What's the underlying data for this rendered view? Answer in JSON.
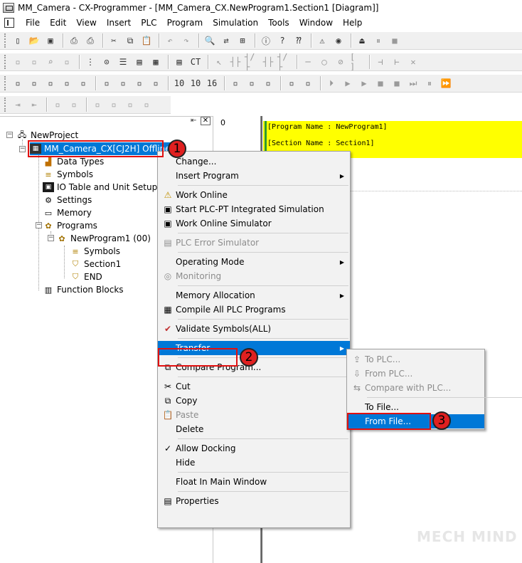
{
  "window": {
    "title": "MM_Camera - CX-Programmer - [MM_Camera_CX.NewProgram1.Section1 [Diagram]]"
  },
  "menubar": [
    "File",
    "Edit",
    "View",
    "Insert",
    "PLC",
    "Program",
    "Simulation",
    "Tools",
    "Window",
    "Help"
  ],
  "toolbars": {
    "row1": [
      "new-icon",
      "open-icon",
      "save-icon",
      "sep",
      "print-preview-icon",
      "print-icon",
      "sep",
      "cut-icon",
      "copy-icon",
      "paste-icon",
      "sep",
      "undo-icon",
      "redo-icon",
      "sep",
      "find-icon",
      "replace-icon",
      "cross-ref-icon",
      "sep",
      "about-icon",
      "help-icon",
      "whats-this-icon",
      "sep",
      "warning-icon",
      "monitor-icon",
      "sep",
      "online-icon",
      "pause-icon",
      "stop-icon"
    ],
    "row2": [
      "tool-a",
      "tool-b",
      "zoom-icon",
      "tool-c",
      "sep",
      "grid-icon",
      "symbol-icon",
      "list-icon",
      "ladder-icon",
      "mnemonic-icon",
      "sep",
      "io-icon",
      "ct-icon",
      "sep",
      "select-icon",
      "contact-no",
      "contact-nc",
      "contact-or",
      "contact-ornc",
      "sep",
      "line-h",
      "coil-icon",
      "coil-nc",
      "instr-icon",
      "sep",
      "block-a",
      "block-b",
      "block-c"
    ],
    "row3": [
      "window-a",
      "window-b",
      "window-c",
      "window-d",
      "window-e",
      "sep",
      "tool-f",
      "tool-g",
      "tool-h",
      "tool-i",
      "sep",
      "num-10",
      "num-10b",
      "num-16",
      "sep",
      "transfer-a",
      "transfer-b",
      "transfer-c",
      "sep",
      "compare-icon",
      "verify-icon",
      "sep",
      "step-icon",
      "run-icon",
      "play-icon",
      "stop-sq",
      "stop-sq2",
      "next-icon",
      "pause-icon2",
      "skip-icon"
    ],
    "row4": [
      "indent-icon",
      "outdent-icon",
      "sep",
      "list-a",
      "list-b",
      "sep",
      "tool-j",
      "tool-k",
      "tool-l",
      "tool-m"
    ]
  },
  "project_tree": {
    "root": "NewProject",
    "plc": "MM_Camera_CX[CJ2H] Offline",
    "items": [
      "Data Types",
      "Symbols",
      "IO Table and Unit Setup",
      "Settings",
      "Memory",
      "Programs"
    ],
    "program": "NewProgram1 (00)",
    "program_children": [
      "Symbols",
      "Section1",
      "END"
    ],
    "function_blocks": "Function Blocks"
  },
  "diagram": {
    "rung_number": "0",
    "program_name_line": "[Program Name : NewProgram1]",
    "section_name_line": "[Section Name : Section1]"
  },
  "context_menu": {
    "items": [
      {
        "label": "Change...",
        "icon": "",
        "disabled": false,
        "submenu": false
      },
      {
        "label": "Insert Program",
        "icon": "",
        "disabled": false,
        "submenu": true
      },
      {
        "sep": true
      },
      {
        "label": "Work Online",
        "icon": "warning-icon",
        "disabled": false,
        "submenu": false
      },
      {
        "label": "Start PLC-PT Integrated Simulation",
        "icon": "simulation-icon",
        "disabled": false,
        "submenu": false
      },
      {
        "label": "Work Online Simulator",
        "icon": "simulator-icon",
        "disabled": false,
        "submenu": false
      },
      {
        "sep": true
      },
      {
        "label": "PLC Error Simulator",
        "icon": "error-sim-icon",
        "disabled": true,
        "submenu": false
      },
      {
        "sep": true
      },
      {
        "label": "Operating Mode",
        "icon": "",
        "disabled": false,
        "submenu": true
      },
      {
        "label": "Monitoring",
        "icon": "monitoring-icon",
        "disabled": true,
        "submenu": false
      },
      {
        "sep": true
      },
      {
        "label": "Memory Allocation",
        "icon": "",
        "disabled": false,
        "submenu": true
      },
      {
        "label": "Compile All PLC Programs",
        "icon": "compile-icon",
        "disabled": false,
        "submenu": false
      },
      {
        "sep": true
      },
      {
        "label": "Validate Symbols(ALL)",
        "icon": "validate-icon",
        "disabled": false,
        "submenu": false
      },
      {
        "sep": true
      },
      {
        "label": "Transfer",
        "icon": "",
        "disabled": false,
        "submenu": true,
        "highlight": true
      },
      {
        "sep": true
      },
      {
        "label": "Compare Program...",
        "icon": "compare-icon",
        "disabled": false,
        "submenu": false
      },
      {
        "sep": true
      },
      {
        "label": "Cut",
        "icon": "cut-icon",
        "disabled": false,
        "submenu": false
      },
      {
        "label": "Copy",
        "icon": "copy-icon",
        "disabled": false,
        "submenu": false
      },
      {
        "label": "Paste",
        "icon": "paste-icon",
        "disabled": true,
        "submenu": false
      },
      {
        "label": "Delete",
        "icon": "",
        "disabled": false,
        "submenu": false
      },
      {
        "sep": true
      },
      {
        "label": "Allow Docking",
        "icon": "check-icon",
        "disabled": false,
        "submenu": false
      },
      {
        "label": "Hide",
        "icon": "",
        "disabled": false,
        "submenu": false
      },
      {
        "sep": true
      },
      {
        "label": "Float In Main Window",
        "icon": "",
        "disabled": false,
        "submenu": false
      },
      {
        "sep": true
      },
      {
        "label": "Properties",
        "icon": "properties-icon",
        "disabled": false,
        "submenu": false
      }
    ]
  },
  "transfer_submenu": {
    "items": [
      {
        "label": "To PLC...",
        "icon": "to-plc-icon",
        "disabled": true
      },
      {
        "label": "From PLC...",
        "icon": "from-plc-icon",
        "disabled": true
      },
      {
        "label": "Compare with PLC...",
        "icon": "compare-plc-icon",
        "disabled": true
      },
      {
        "sep": true
      },
      {
        "label": "To File...",
        "icon": "",
        "disabled": false
      },
      {
        "label": "From File...",
        "icon": "",
        "disabled": false,
        "highlight": true
      }
    ]
  },
  "annotations": {
    "step1": "1",
    "step2": "2",
    "step3": "3"
  },
  "watermark": "MECH MIND",
  "colors": {
    "highlight": "#0078d7",
    "callout": "#e01010",
    "diagram_header": "#ffff00"
  }
}
